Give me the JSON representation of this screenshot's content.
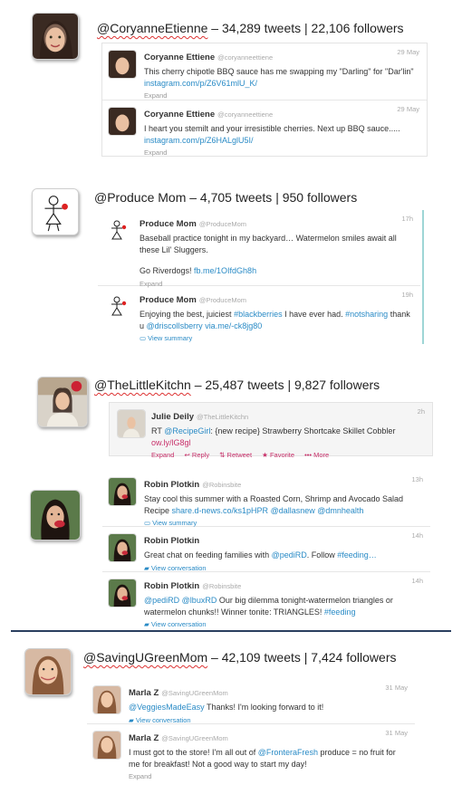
{
  "sections": [
    {
      "header": {
        "handle": "@CoryanneEtienne",
        "stats": " – 34,289 tweets | 22,106 followers"
      },
      "tweets": [
        {
          "name": "Coryanne Ettiene",
          "username": "@coryanneettiene",
          "time": "29 May",
          "text_pre": "This cherry chipotle BBQ sauce has me swapping my \"Darling\" for \"Dar'lin\" ",
          "link": "instagram.com/p/Z6V61mlU_K/",
          "footer": "Expand"
        },
        {
          "name": "Coryanne Ettiene",
          "username": "@coryanneettiene",
          "time": "29 May",
          "text_pre": "I heart you stemilt and your irresistible cherries. Next up BBQ sauce..... ",
          "link": "instagram.com/p/Z6HALglU5I/",
          "footer": "Expand"
        }
      ]
    },
    {
      "header": {
        "handle": "@Produce Mom",
        "stats": " – 4,705 tweets | 950 followers"
      },
      "tweets": [
        {
          "name": "Produce Mom",
          "username": "@ProduceMom",
          "time": "17h",
          "text_pre": "Baseball practice tonight in my backyard… Watermelon smiles await all these Lil' Sluggers.",
          "text_pre2": "Go Riverdogs! ",
          "link": "fb.me/1OIfdGh8h",
          "footer": "Expand"
        },
        {
          "name": "Produce Mom",
          "username": "@ProduceMom",
          "time": "19h",
          "text_pre": "Enjoying the best, juiciest ",
          "link": "#blackberries",
          "text_mid": " I have ever had. ",
          "link2": "#notsharing",
          "text_mid2": " thank u ",
          "link3": "@driscollsberry",
          "text_mid3": "   ",
          "link4": "via.me/-ck8jg80",
          "footer": "View summary"
        }
      ]
    },
    {
      "header": {
        "handle": "@TheLittleKitchn",
        "stats": " – 25,487 tweets | 9,827 followers"
      },
      "tweets": [
        {
          "name": "Julie Deily",
          "username": "@TheLittleKitchn",
          "time": "2h",
          "text_pre": "RT ",
          "link": "@RecipeGirl",
          "text_mid": ": {new recipe} Strawberry Shortcake Skillet Cobbler ",
          "link2": "ow.ly/lG8gl",
          "actions": [
            "Expand",
            "↩ Reply",
            "⇅ Retweet",
            "★ Favorite",
            "••• More"
          ]
        },
        {
          "name": "Robin Plotkin",
          "username": "@Robinsbite",
          "time": "13h",
          "text_pre": "Stay cool this summer with a Roasted Corn, Shrimp and Avocado Salad Recipe ",
          "link": "share.d-news.co/ks1pHPR",
          "text_mid": " ",
          "link2": "@dallasnew",
          "text_mid2": " ",
          "link3": "@dmnhealth",
          "footer": "View summary"
        },
        {
          "name": "Robin Plotkin",
          "username": "@Robinsbite",
          "time": "14h",
          "text_pre": "Great chat on feeding families with ",
          "link": "@pediRD",
          "text_mid": ". Follow ",
          "link2": "#feeding…",
          "footer": "View conversation"
        },
        {
          "name": "Robin Plotkin",
          "username": "@Robinsbite",
          "time": "14h",
          "link": "@pediRD",
          "text_mid": " ",
          "link2": "@lbuxRD",
          "text_mid2": " Our big dilemma tonight-watermelon triangles or watermelon chunks!! Winner tonite: TRIANGLES! ",
          "link3": "#feeding",
          "footer": "View conversation"
        }
      ]
    },
    {
      "header": {
        "handle": "@SavingUGreenMom",
        "stats": " – 42,109 tweets | 7,424 followers"
      },
      "tweets": [
        {
          "name": "Marla Z",
          "username": "@SavingUGreenMom",
          "time": "31 May",
          "link": "@VeggiesMadeEasy",
          "text_mid": " Thanks! I'm looking forward to it!",
          "footer": "View conversation"
        },
        {
          "name": "Marla Z",
          "username": "@SavingUGreenMom",
          "time": "31 May",
          "text_pre": "I must got to the store! I'm all out of ",
          "link": "@FronteraFresh",
          "text_mid": " produce = no fruit for me for breakfast! Not a good way to start my day!",
          "footer": "Expand"
        }
      ]
    }
  ],
  "icons": {
    "summary": "summary-icon",
    "conversation": "speech-bubble-icon"
  },
  "colors": {
    "link": "#2a8bc6",
    "action": "#c8306a",
    "divider": "#2a3f5f"
  }
}
